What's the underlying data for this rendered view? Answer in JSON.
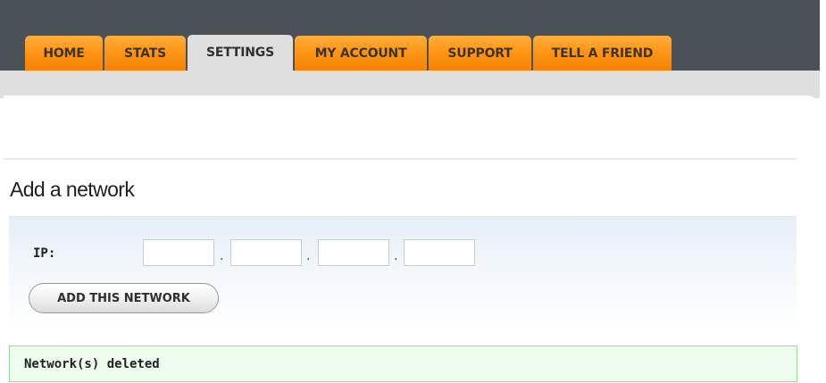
{
  "nav": {
    "tabs": [
      {
        "label": "HOME",
        "active": false
      },
      {
        "label": "STATS",
        "active": false
      },
      {
        "label": "SETTINGS",
        "active": true
      },
      {
        "label": "MY ACCOUNT",
        "active": false
      },
      {
        "label": "SUPPORT",
        "active": false
      },
      {
        "label": "TELL A FRIEND",
        "active": false
      }
    ]
  },
  "add_network": {
    "title": "Add a network",
    "ip_label": "IP:",
    "ip_octets": [
      "",
      "",
      "",
      ""
    ],
    "separator": ".",
    "button_label": "ADD THIS NETWORK"
  },
  "status": {
    "message": "Network(s) deleted"
  },
  "colors": {
    "topbar": "#4b5257",
    "tab_orange": "#ff9414",
    "tab_active": "#dfdfdf",
    "status_border": "#9ed69e",
    "status_bg": "#eefcee"
  }
}
